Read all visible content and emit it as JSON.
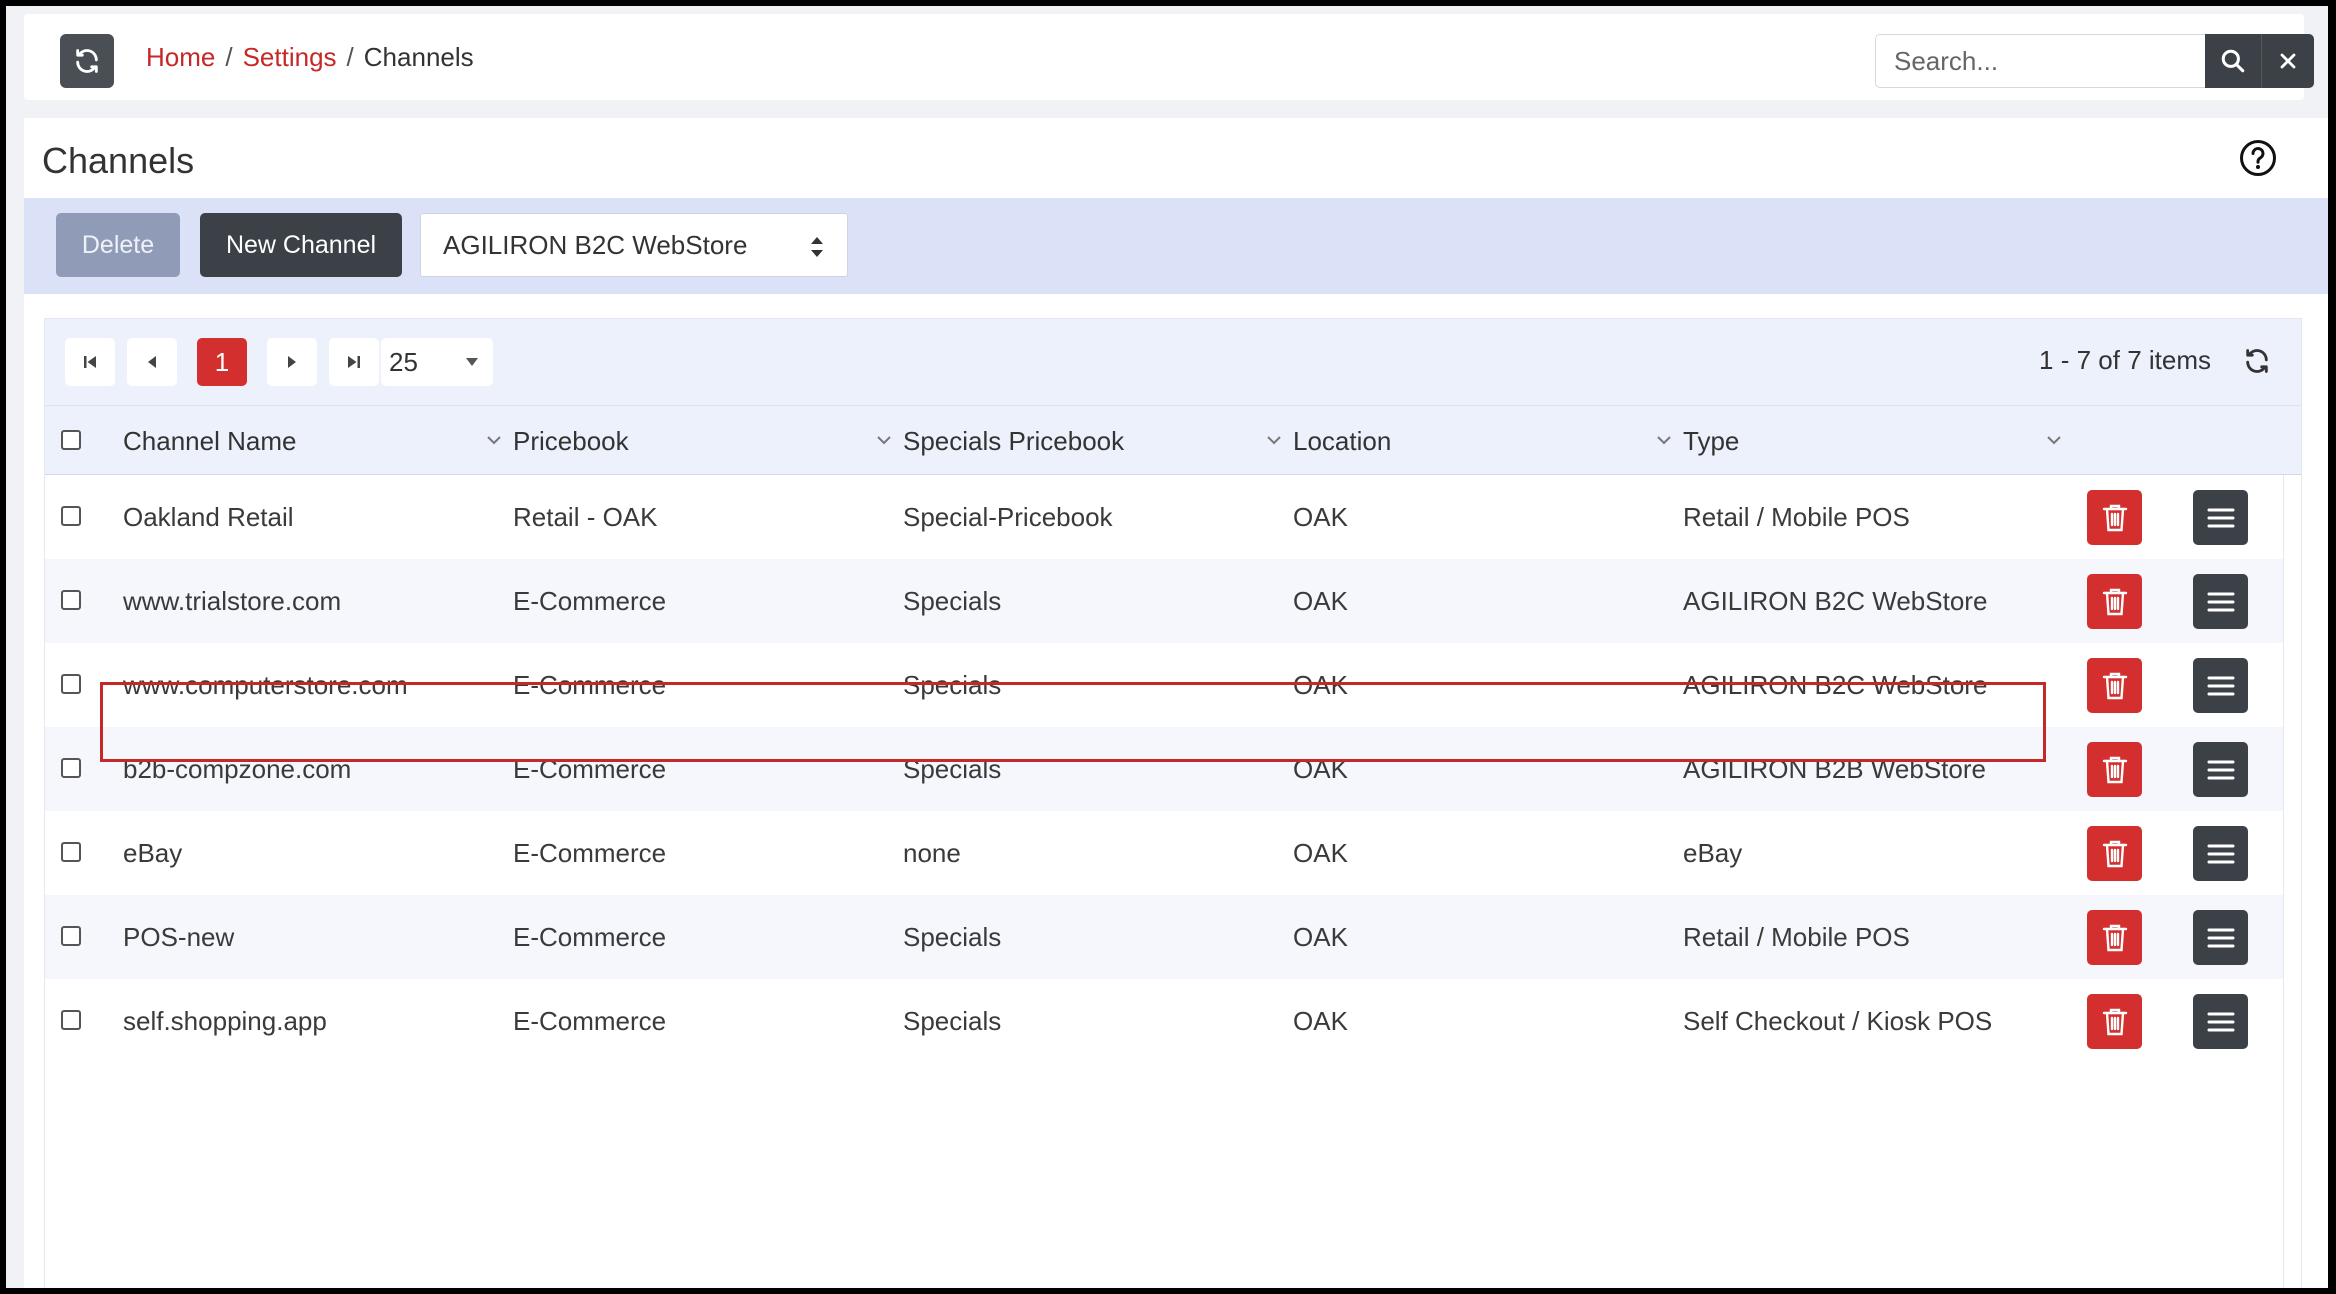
{
  "breadcrumb": {
    "home": "Home",
    "settings": "Settings",
    "current": "Channels",
    "sep": "/"
  },
  "search": {
    "placeholder": "Search..."
  },
  "page": {
    "title": "Channels"
  },
  "toolbar": {
    "delete_label": "Delete",
    "new_label": "New Channel",
    "type_selected": "AGILIRON B2C WebStore"
  },
  "pager": {
    "current_page": "1",
    "page_size": "25",
    "items_info": "1 - 7 of 7 items"
  },
  "columns": [
    "Channel Name",
    "Pricebook",
    "Specials Pricebook",
    "Location",
    "Type"
  ],
  "rows": [
    {
      "name": "Oakland Retail",
      "pricebook": "Retail - OAK",
      "specials": "Special-Pricebook",
      "location": "OAK",
      "type": "Retail / Mobile POS"
    },
    {
      "name": "www.trialstore.com",
      "pricebook": "E-Commerce",
      "specials": "Specials",
      "location": "OAK",
      "type": "AGILIRON B2C WebStore"
    },
    {
      "name": "www.computerstore.com",
      "pricebook": "E-Commerce",
      "specials": "Specials",
      "location": "OAK",
      "type": "AGILIRON B2C WebStore"
    },
    {
      "name": "b2b-compzone.com",
      "pricebook": "E-Commerce",
      "specials": "Specials",
      "location": "OAK",
      "type": "AGILIRON B2B WebStore"
    },
    {
      "name": "eBay",
      "pricebook": "E-Commerce",
      "specials": "none",
      "location": "OAK",
      "type": "eBay"
    },
    {
      "name": "POS-new",
      "pricebook": "E-Commerce",
      "specials": "Specials",
      "location": "OAK",
      "type": "Retail / Mobile POS"
    },
    {
      "name": "self.shopping.app",
      "pricebook": "E-Commerce",
      "specials": "Specials",
      "location": "OAK",
      "type": "Self Checkout / Kiosk POS"
    }
  ],
  "colors": {
    "accent": "#c62828",
    "dark_button": "#3c4047",
    "toolbar_bg": "#dbe2f8",
    "grid_header_bg": "#edf1fb"
  },
  "icons": [
    "refresh-icon",
    "search-icon",
    "close-icon",
    "help-icon",
    "up-down-icon",
    "first-page-icon",
    "prev-page-icon",
    "next-page-icon",
    "last-page-icon",
    "caret-down-icon",
    "chevron-down-icon",
    "trash-icon",
    "hamburger-menu-icon"
  ]
}
